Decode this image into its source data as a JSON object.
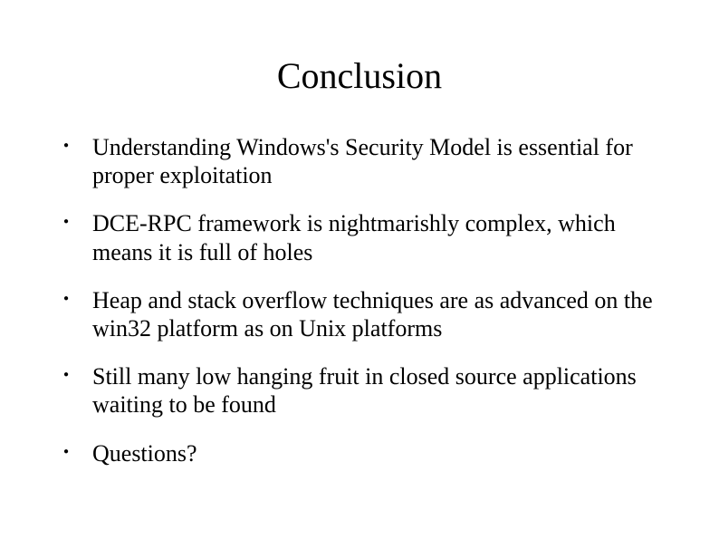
{
  "title": "Conclusion",
  "bullets": [
    "Understanding Windows's Security Model is essential for proper exploitation",
    "DCE-RPC framework is nightmarishly complex, which means it is full of holes",
    "Heap and stack overflow techniques are as advanced on the win32 platform as on Unix platforms",
    "Still many low hanging fruit in closed source applications waiting to be found",
    "Questions?"
  ]
}
